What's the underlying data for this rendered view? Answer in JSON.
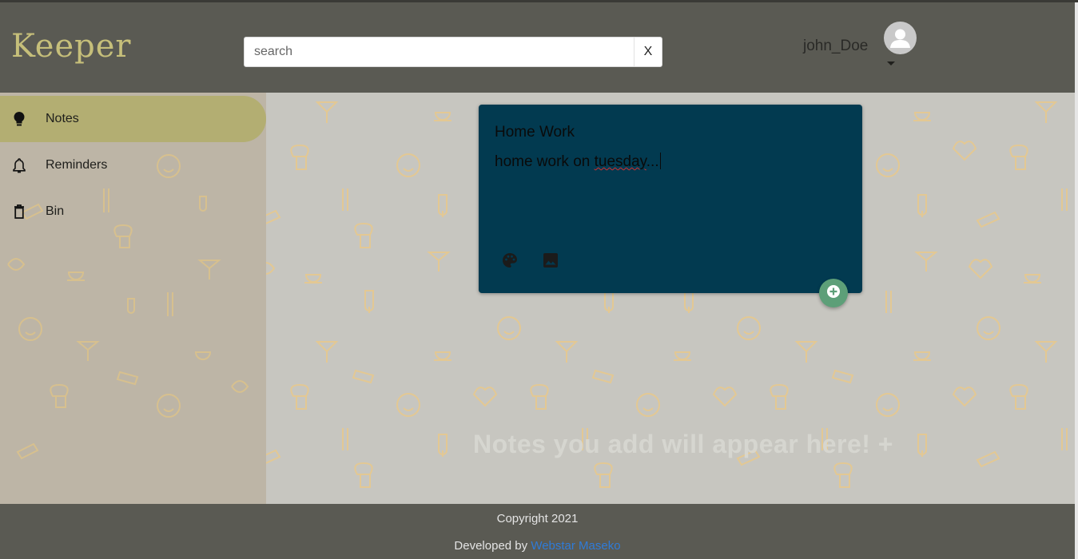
{
  "header": {
    "logo": "Keeper",
    "search_placeholder": "search",
    "search_value": "",
    "clear_label": "X",
    "username": "john_Doe"
  },
  "sidebar": {
    "items": [
      {
        "label": "Notes",
        "icon": "lightbulb-icon",
        "active": true
      },
      {
        "label": "Reminders",
        "icon": "bell-icon",
        "active": false
      },
      {
        "label": "Bin",
        "icon": "trash-icon",
        "active": false
      }
    ]
  },
  "note": {
    "title": "Home Work",
    "body_prefix": "home work on ",
    "body_misspelled": "tuesday",
    "body_suffix": "...",
    "tools": [
      "palette-icon",
      "image-icon"
    ],
    "add_icon": "add-circle-icon"
  },
  "main": {
    "empty_message": "Notes you add will appear here! +"
  },
  "footer": {
    "copyright": "Copyright 2021",
    "developed_by": "Developed by ",
    "author": "Webstar Maseko"
  },
  "colors": {
    "header_bg": "#5a5a53",
    "logo": "#c6bf7a",
    "active_nav": "#b3ae72",
    "note_bg": "#023a50",
    "add_button": "#5d9f78",
    "link": "#2f7bd8"
  }
}
